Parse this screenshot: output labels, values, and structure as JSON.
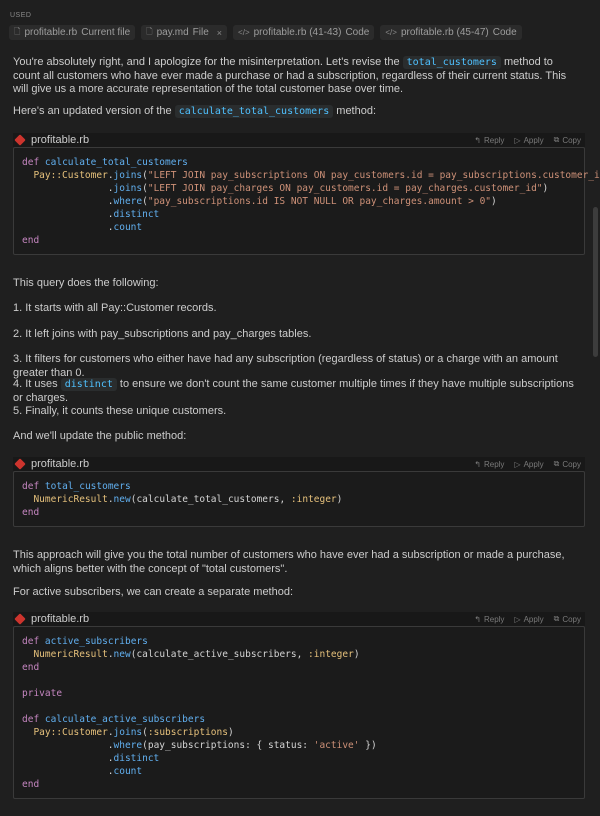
{
  "used_label": "USED",
  "chips": [
    {
      "icon": "file-icon",
      "name": "profitable.rb",
      "kind": "Current file",
      "closable": false
    },
    {
      "icon": "file-icon",
      "name": "pay.md",
      "kind": "File",
      "closable": true
    },
    {
      "icon": "code-icon",
      "name": "profitable.rb (41-43)",
      "kind": "Code",
      "closable": false
    },
    {
      "icon": "code-icon",
      "name": "profitable.rb (45-47)",
      "kind": "Code",
      "closable": false
    }
  ],
  "intro": {
    "pre": "You're absolutely right, and I apologize for the misinterpretation. Let's revise the ",
    "code": "total_customers",
    "post": " method to count all customers who have ever made a purchase or had a subscription, regardless of their current status. This will give us a more accurate representation of the total customer base over time."
  },
  "updated_version": {
    "pre": "Here's an updated version of the ",
    "code": "calculate_total_customers",
    "post": " method:"
  },
  "code_actions": {
    "reply": "Reply",
    "apply": "Apply",
    "copy": "Copy"
  },
  "code_blocks": [
    {
      "filename": "profitable.rb"
    },
    {
      "filename": "profitable.rb"
    },
    {
      "filename": "profitable.rb"
    }
  ],
  "query_intro": "This query does the following:",
  "steps": {
    "s1": "1. It starts with all Pay::Customer records.",
    "s2": "2. It left joins with pay_subscriptions and pay_charges tables.",
    "s3": "3. It filters for customers who either have had any subscription (regardless of status) or a charge with an amount greater than 0.",
    "s4_pre": "4. It uses ",
    "s4_code": "distinct",
    "s4_post": " to ensure we don't count the same customer multiple times if they have multiple subscriptions or charges.",
    "s5": "5. Finally, it counts these unique customers."
  },
  "public_method": "And we'll update the public method:",
  "approach": "This approach will give you the total number of customers who have ever had a subscription or made a purchase, which aligns better with the concept of \"total customers\".",
  "active_subscribers": "For active subscribers, we can create a separate method:",
  "code": {
    "b1": {
      "l1_def": "def",
      "l1_fn": "calculate_total_customers",
      "l2_cls": "Pay::Customer",
      "l2_m": "joins",
      "l2_str": "\"LEFT JOIN pay_subscriptions ON pay_customers.id = pay_subscriptions.customer_id\"",
      "l3_m": "joins",
      "l3_str": "\"LEFT JOIN pay_charges ON pay_customers.id = pay_charges.customer_id\"",
      "l4_m": "where",
      "l4_str": "\"pay_subscriptions.id IS NOT NULL OR pay_charges.amount > 0\"",
      "l5_m": "distinct",
      "l6_m": "count",
      "l7_end": "end"
    },
    "b2": {
      "l1_def": "def",
      "l1_fn": "total_customers",
      "l2_cls": "NumericResult",
      "l2_m": "new",
      "l2_args": "calculate_total_customers, ",
      "l2_sym": ":integer",
      "l3_end": "end"
    },
    "b3": {
      "l1_def": "def",
      "l1_fn": "active_subscribers",
      "l2_cls": "NumericResult",
      "l2_m": "new",
      "l2_args": "calculate_active_subscribers, ",
      "l2_sym": ":integer",
      "l3_end": "end",
      "private": "private",
      "l5_def": "def",
      "l5_fn": "calculate_active_subscribers",
      "l6_cls": "Pay::Customer",
      "l6_m": "joins",
      "l6_sym": ":subscriptions",
      "l7_m": "where",
      "l7_args": "pay_subscriptions: { status: ",
      "l7_str": "'active'",
      "l7_close": " }",
      "l8_m": "distinct",
      "l9_m": "count",
      "l10_end": "end"
    }
  }
}
